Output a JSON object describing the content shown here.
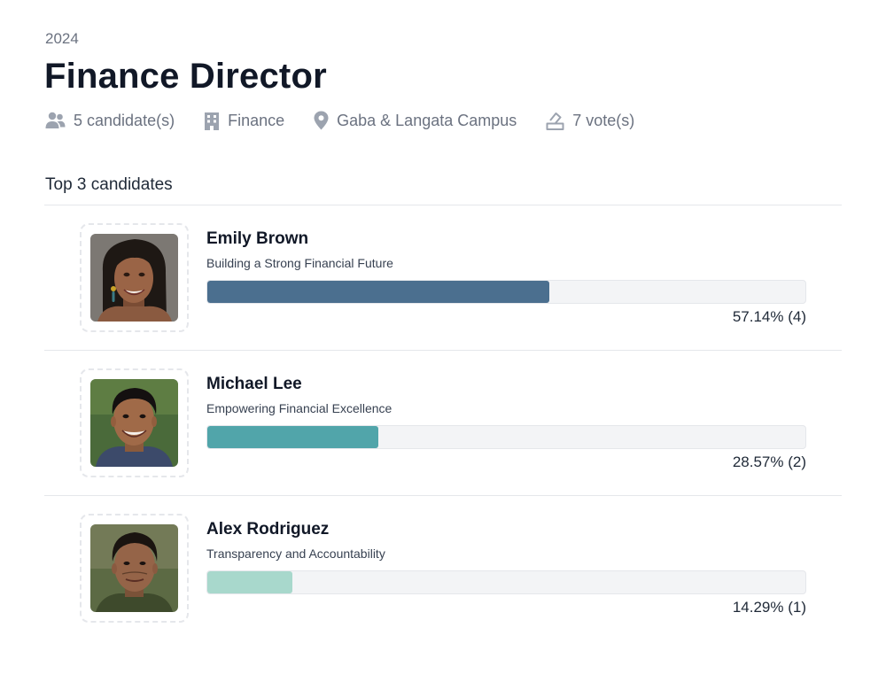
{
  "position": {
    "year": "2024",
    "title": "Finance Director",
    "meta": {
      "candidates": "5 candidate(s)",
      "department": "Finance",
      "location": "Gaba & Langata Campus",
      "votes": "7 vote(s)"
    }
  },
  "section_title": "Top 3 candidates",
  "candidates": [
    {
      "name": "Emily Brown",
      "slogan": "Building a Strong Financial Future",
      "percent": 57.14,
      "result": "57.14% (4)",
      "bar_color": "#4b6f8f",
      "avatar": "woman-smiling-portrait"
    },
    {
      "name": "Michael Lee",
      "slogan": "Empowering Financial Excellence",
      "percent": 28.57,
      "result": "28.57% (2)",
      "bar_color": "#51a5aa",
      "avatar": "man-smiling-portrait"
    },
    {
      "name": "Alex Rodriguez",
      "slogan": "Transparency and Accountability",
      "percent": 14.29,
      "result": "14.29% (1)",
      "bar_color": "#a8d8cc",
      "avatar": "man-portrait"
    }
  ],
  "colors": {
    "text_primary": "#111827",
    "text_muted": "#6b7280",
    "divider": "#e5e7eb",
    "bar_track": "#f3f4f6"
  }
}
